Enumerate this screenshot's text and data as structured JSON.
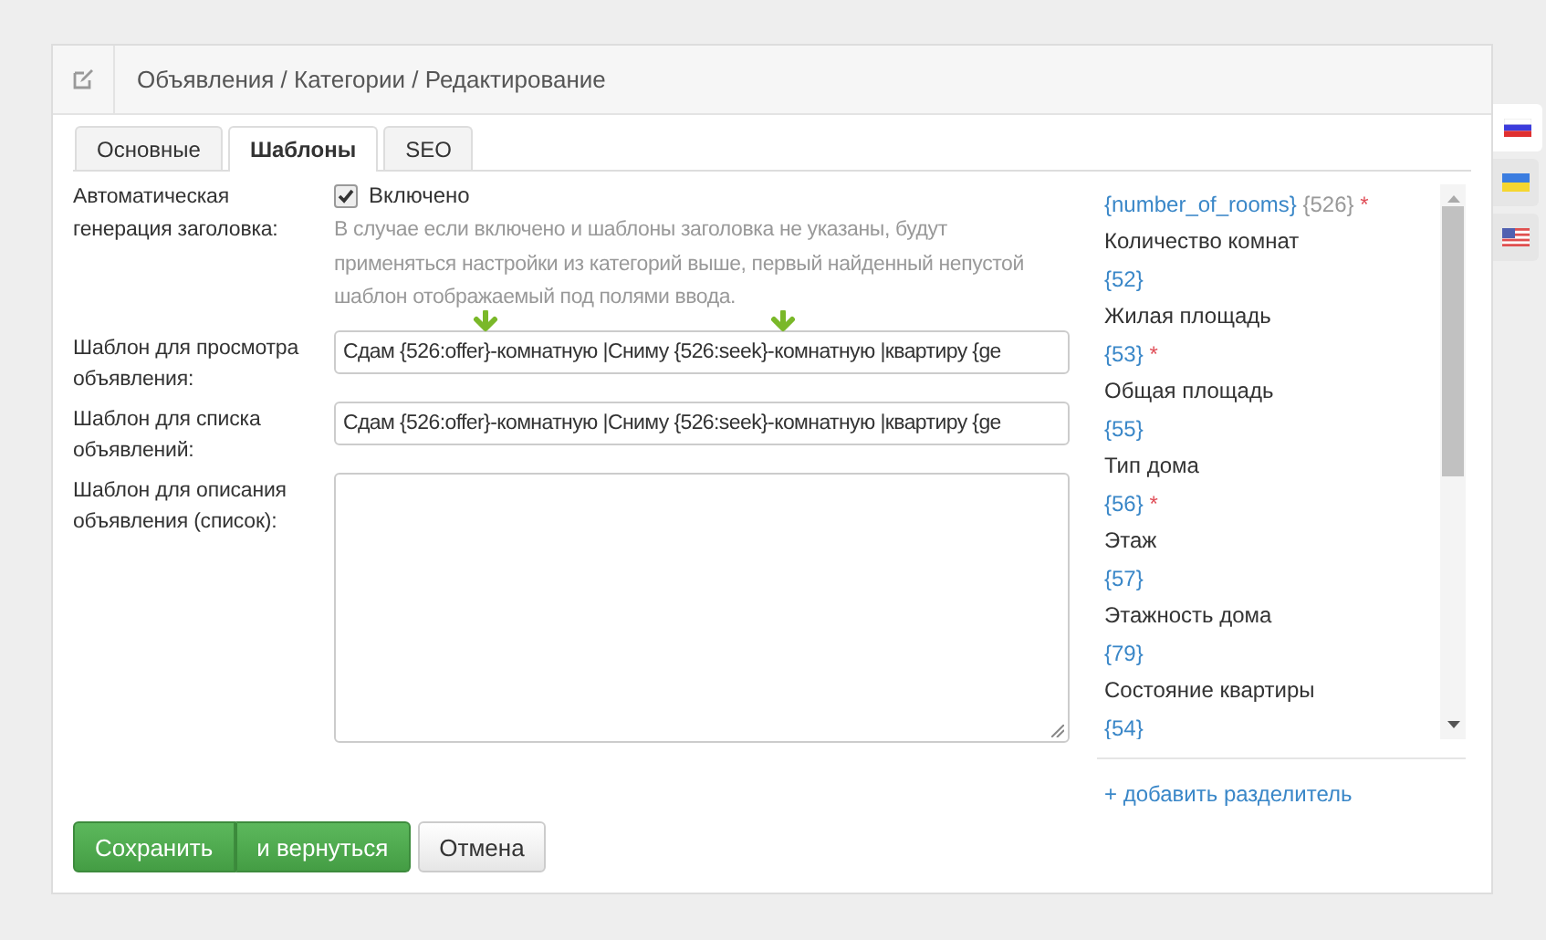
{
  "header": {
    "breadcrumb": "Объявления / Категории / Редактирование"
  },
  "tabs": [
    {
      "label": "Основные",
      "selected": false
    },
    {
      "label": "Шаблоны",
      "selected": true
    },
    {
      "label": "SEO",
      "selected": false
    }
  ],
  "auto_title": {
    "label": "Автоматическая генерация заголовка:",
    "checkbox_label": "Включено",
    "checked": true,
    "hint": "В случае если включено и шаблоны заголовка не указаны, будут применяться настройки из категорий выше, первый найденный непустой шаблон отображаемый под полями ввода."
  },
  "fields": [
    {
      "kind": "input",
      "label": "Шаблон для просмотра объявления:",
      "value": "Сдам {526:offer}-комнатную |Сниму {526:seek}-комнатную |квартиру {ge"
    },
    {
      "kind": "input",
      "label": "Шаблон для списка объявлений:",
      "value": "Сдам {526:offer}-комнатную |Сниму {526:seek}-комнатную |квартиру {ge"
    },
    {
      "kind": "textarea",
      "label": "Шаблон для описания объявления (список):"
    }
  ],
  "variables": [
    {
      "key": "{number_of_rooms}",
      "id": "{526}",
      "mark": "*",
      "name": "Количество комнат"
    },
    {
      "key": "{52}",
      "name": "Жилая площадь"
    },
    {
      "key": "{53}",
      "mark": "*",
      "name": "Общая площадь"
    },
    {
      "key": "{55}",
      "name": "Тип дома"
    },
    {
      "key": "{56}",
      "mark": "*",
      "name": "Этаж"
    },
    {
      "key": "{57}",
      "name": "Этажность дома"
    },
    {
      "key": "{79}",
      "name": "Состояние квартиры"
    },
    {
      "key": "{54}"
    }
  ],
  "add_separator": "+ добавить разделитель",
  "buttons": [
    {
      "kind": "success",
      "label": "Сохранить"
    },
    {
      "kind": "success-split",
      "label": "и вернуться"
    },
    {
      "kind": "default",
      "label": "Отмена"
    }
  ],
  "languages": [
    {
      "kind": "ru",
      "selected": true
    },
    {
      "kind": "ua",
      "selected": false
    },
    {
      "kind": "us",
      "selected": false
    }
  ]
}
